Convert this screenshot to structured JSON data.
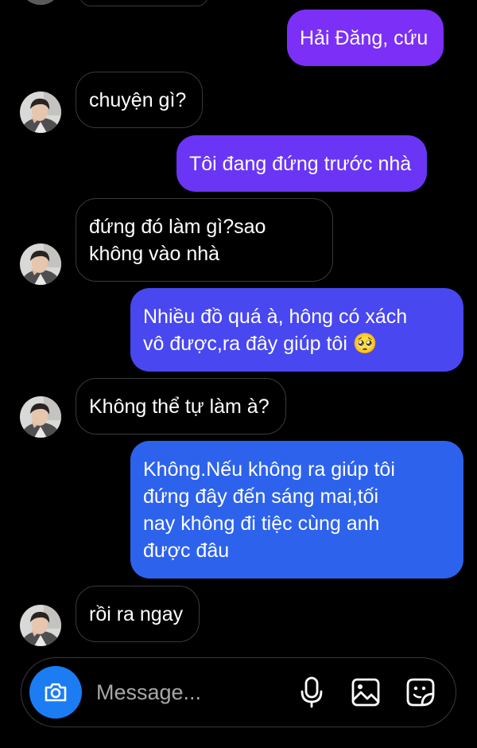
{
  "colors": {
    "bubble_out_1": "#7b2ff7",
    "bubble_out_2": "#6a35f5",
    "bubble_out_3": "#4847f0",
    "bubble_out_4": "#2d62ec",
    "camera_button": "#1b7cf4"
  },
  "messages": [
    {
      "side": "out",
      "text": "Hải Đăng, cứu"
    },
    {
      "side": "in",
      "text": "chuyện gì?"
    },
    {
      "side": "out",
      "text": "Tôi đang đứng trước nhà"
    },
    {
      "side": "in",
      "text": "đứng đó làm gì?sao\nkhông vào nhà"
    },
    {
      "side": "out",
      "text": "Nhiều đồ quá à, hông có xách\nvô được,ra đây giúp tôi 🥺"
    },
    {
      "side": "in",
      "text": "Không thể tự làm à?"
    },
    {
      "side": "out",
      "text": "Không.Nếu không ra giúp tôi\nđứng đây đến sáng mai,tối\nnay không đi tiệc cùng anh\nđược đâu"
    },
    {
      "side": "in",
      "text": "rồi ra ngay"
    }
  ],
  "composer": {
    "placeholder": "Message...",
    "icons": [
      "camera-icon",
      "microphone-icon",
      "image-gallery-icon",
      "sticker-icon"
    ]
  }
}
